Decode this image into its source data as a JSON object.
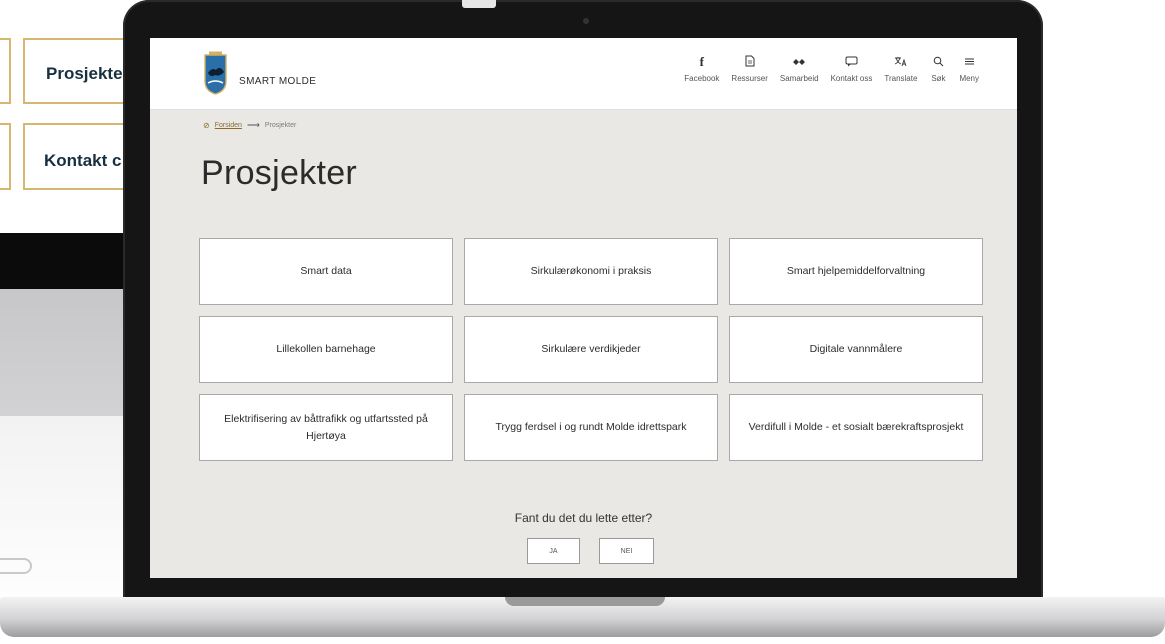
{
  "background": {
    "cards": [
      "Prosjekte",
      "Kontakt c"
    ]
  },
  "site": {
    "brand": "SMART MOLDE",
    "nav": [
      {
        "label": "Facebook",
        "icon": "facebook-icon",
        "glyph": "f"
      },
      {
        "label": "Ressurser",
        "icon": "document-icon",
        "glyph": "▤"
      },
      {
        "label": "Samarbeid",
        "icon": "collaboration-icon",
        "glyph": "⁂"
      },
      {
        "label": "Kontakt oss",
        "icon": "chat-icon",
        "glyph": "▭"
      },
      {
        "label": "Translate",
        "icon": "translate-icon",
        "glyph": "文"
      },
      {
        "label": "Søk",
        "icon": "search-icon",
        "glyph": "⚲"
      },
      {
        "label": "Meny",
        "icon": "menu-icon",
        "glyph": "≡"
      }
    ],
    "breadcrumb": {
      "home": "Forsiden",
      "current": "Prosjekter"
    },
    "title": "Prosjekter",
    "projects": [
      "Smart data",
      "Sirkulærøkonomi i praksis",
      "Smart hjelpemiddelforvaltning",
      "Lillekollen barnehage",
      "Sirkulære verdikjeder",
      "Digitale vannmålere",
      "Elektrifisering av båttrafikk og utfartssted på Hjertøya",
      "Trygg ferdsel i og rundt Molde idrettspark",
      "Verdifull i Molde - et sosialt bærekraftsprosjekt"
    ],
    "feedback": {
      "question": "Fant du det du lette etter?",
      "yes": "JA",
      "no": "NEI"
    }
  },
  "colors": {
    "accent_gold": "#d9b572",
    "screen_bg": "#e9e8e4",
    "text_dark": "#2b2b2b"
  }
}
